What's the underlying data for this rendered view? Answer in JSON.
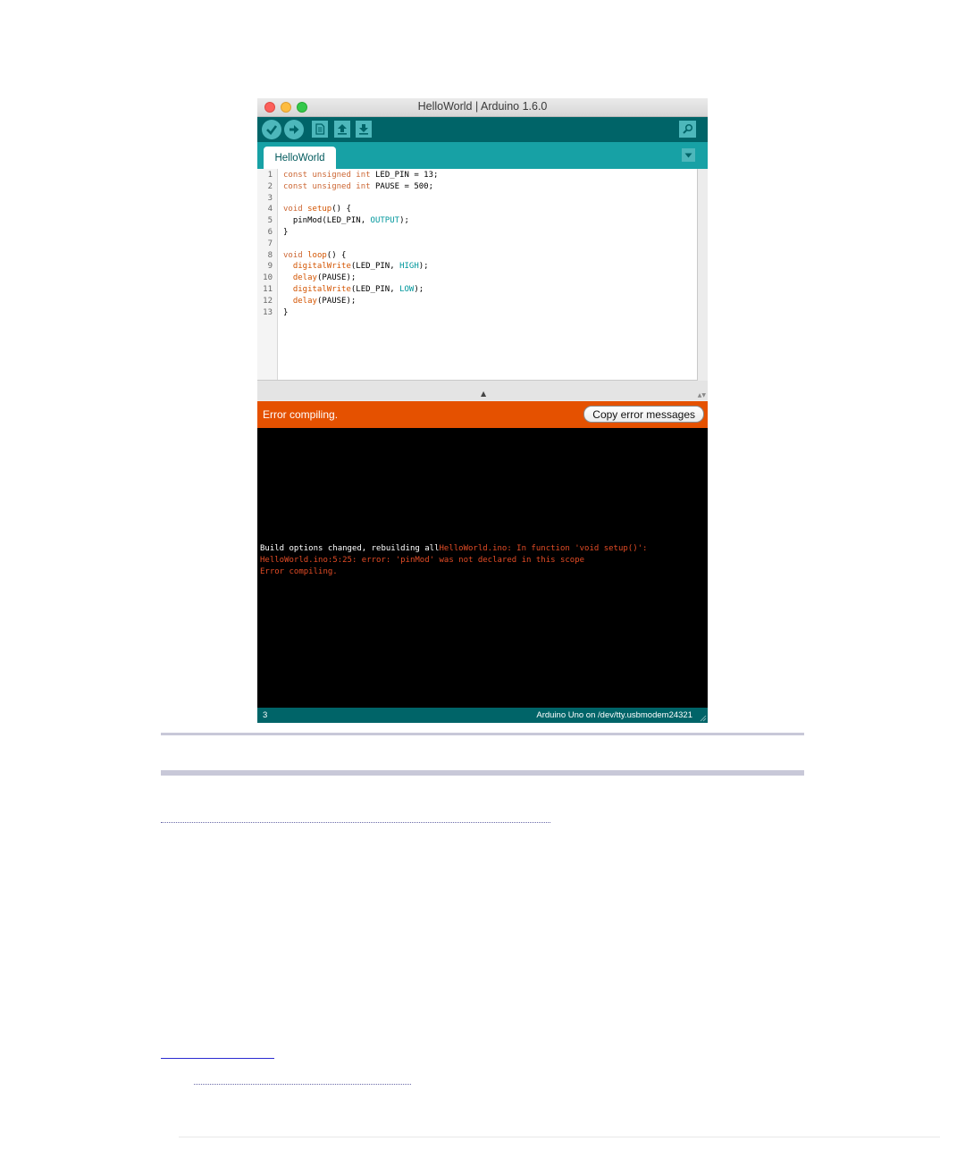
{
  "window": {
    "title": "HelloWorld | Arduino 1.6.0",
    "toolbar": {
      "verify_icon": "checkmark-icon",
      "upload_icon": "right-arrow-icon",
      "new_icon": "new-file-icon",
      "open_icon": "open-arrow-up-icon",
      "save_icon": "save-arrow-down-icon",
      "serial_monitor_icon": "magnifier-icon"
    },
    "tab": {
      "label": "HelloWorld"
    },
    "editor": {
      "lines": [
        {
          "n": "1",
          "text": "const unsigned int LED_PIN = 13;"
        },
        {
          "n": "2",
          "text": "const unsigned int PAUSE = 500;"
        },
        {
          "n": "3",
          "text": ""
        },
        {
          "n": "4",
          "text": "void setup() {"
        },
        {
          "n": "5",
          "text": "  pinMod(LED_PIN, OUTPUT);"
        },
        {
          "n": "6",
          "text": "}"
        },
        {
          "n": "7",
          "text": ""
        },
        {
          "n": "8",
          "text": "void loop() {"
        },
        {
          "n": "9",
          "text": "  digitalWrite(LED_PIN, HIGH);"
        },
        {
          "n": "10",
          "text": "  delay(PAUSE);"
        },
        {
          "n": "11",
          "text": "  digitalWrite(LED_PIN, LOW);"
        },
        {
          "n": "12",
          "text": "  delay(PAUSE);"
        },
        {
          "n": "13",
          "text": "}"
        }
      ]
    },
    "status": {
      "message": "Error compiling.",
      "copy_button": "Copy error messages"
    },
    "console": {
      "line1_white": "Build options changed, rebuilding all",
      "line1_red": "HelloWorld.ino: In function 'void setup()':",
      "line2": "HelloWorld.ino:5:25: error: 'pinMod' was not declared in this scope",
      "line3": "Error compiling."
    },
    "bottom": {
      "line_number": "3",
      "board": "Arduino Uno on /dev/tty.usbmodem24321"
    }
  },
  "colors": {
    "toolbar": "#006468",
    "tabs": "#17a1a5",
    "error_bar": "#e55100",
    "console_error": "#e34c26"
  }
}
